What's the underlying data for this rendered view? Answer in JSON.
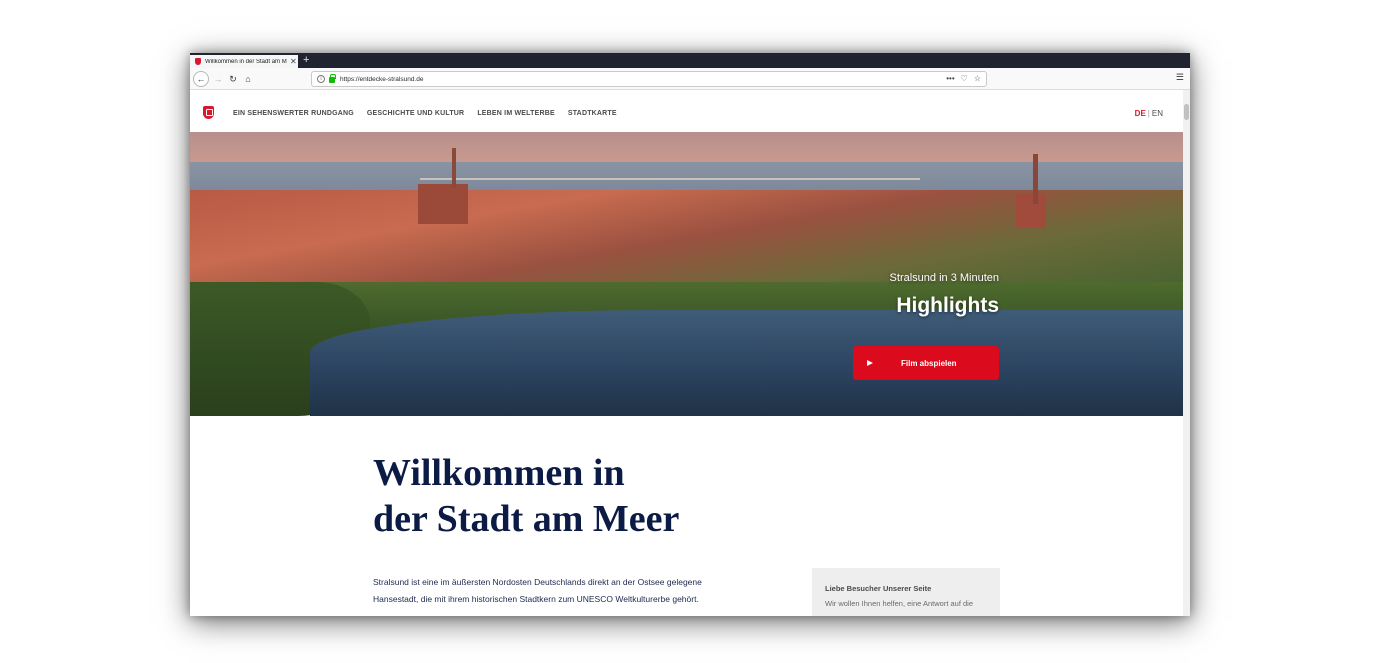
{
  "browser": {
    "tab_title": "Willkommen in der Stadt am Meer",
    "new_tab": "+",
    "url": "https://entdecke-stralsund.de",
    "url_actions": "•••"
  },
  "site": {
    "nav": [
      "EIN SEHENSWERTER RUNDGANG",
      "GESCHICHTE UND KULTUR",
      "LEBEN IM WELTERBE",
      "STADTKARTE"
    ],
    "lang": {
      "de": "DE",
      "separator": "|",
      "en": "EN"
    },
    "hero": {
      "subtitle": "Stralsund in 3 Minuten",
      "title": "Highlights",
      "button_label": "Film abspielen"
    },
    "welcome": {
      "line1": "Willkommen in",
      "line2": "der Stadt am Meer"
    },
    "intro": "Stralsund ist eine im äußersten Nordosten Deutschlands direkt an der Ostsee gelegene Hansestadt, die mit ihrem historischen Stadtkern zum UNESCO Weltkulturerbe gehört.",
    "sidebox": {
      "title": "Liebe Besucher Unserer Seite",
      "text": "Wir wollen Ihnen helfen, eine Antwort auf die"
    }
  },
  "colors": {
    "accent_red": "#dc0a1d",
    "heading_navy": "#0c1b45"
  }
}
